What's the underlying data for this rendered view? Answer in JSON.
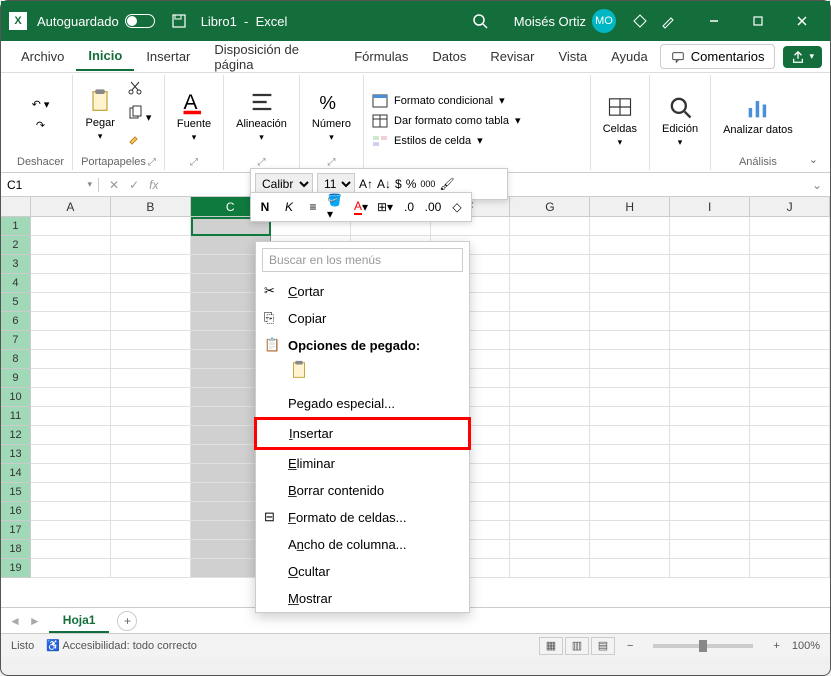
{
  "titlebar": {
    "autosave_label": "Autoguardado",
    "filename": "Libro1",
    "app": "Excel",
    "username": "Moisés Ortiz",
    "user_initials": "MO"
  },
  "menu": {
    "tabs": [
      "Archivo",
      "Inicio",
      "Insertar",
      "Disposición de página",
      "Fórmulas",
      "Datos",
      "Revisar",
      "Vista",
      "Ayuda"
    ],
    "active_index": 1,
    "comments": "Comentarios"
  },
  "ribbon": {
    "undo": "Deshacer",
    "clipboard": "Portapapeles",
    "paste": "Pegar",
    "font": "Fuente",
    "alignment": "Alineación",
    "number": "Número",
    "cond_format": "Formato condicional",
    "format_table": "Dar formato como tabla",
    "cell_styles": "Estilos de celda",
    "cells": "Celdas",
    "editing": "Edición",
    "analyze": "Analizar datos",
    "analysis": "Análisis"
  },
  "mini_toolbar": {
    "font_name": "Calibri",
    "font_size": "11"
  },
  "formula": {
    "name_box": "C1"
  },
  "grid": {
    "columns": [
      "A",
      "B",
      "C",
      "D",
      "E",
      "F",
      "G",
      "H",
      "I",
      "J"
    ],
    "selected_col_index": 2,
    "row_count": 19
  },
  "context_menu": {
    "search_placeholder": "Buscar en los menús",
    "cut": "Cortar",
    "copy": "Copiar",
    "paste_options": "Opciones de pegado:",
    "paste_special": "Pegado especial...",
    "insert": "Insertar",
    "delete": "Eliminar",
    "clear": "Borrar contenido",
    "format_cells": "Formato de celdas...",
    "col_width": "Ancho de columna...",
    "hide": "Ocultar",
    "show": "Mostrar"
  },
  "sheets": {
    "active": "Hoja1"
  },
  "status": {
    "ready": "Listo",
    "accessibility": "Accesibilidad: todo correcto",
    "zoom": "100%"
  }
}
